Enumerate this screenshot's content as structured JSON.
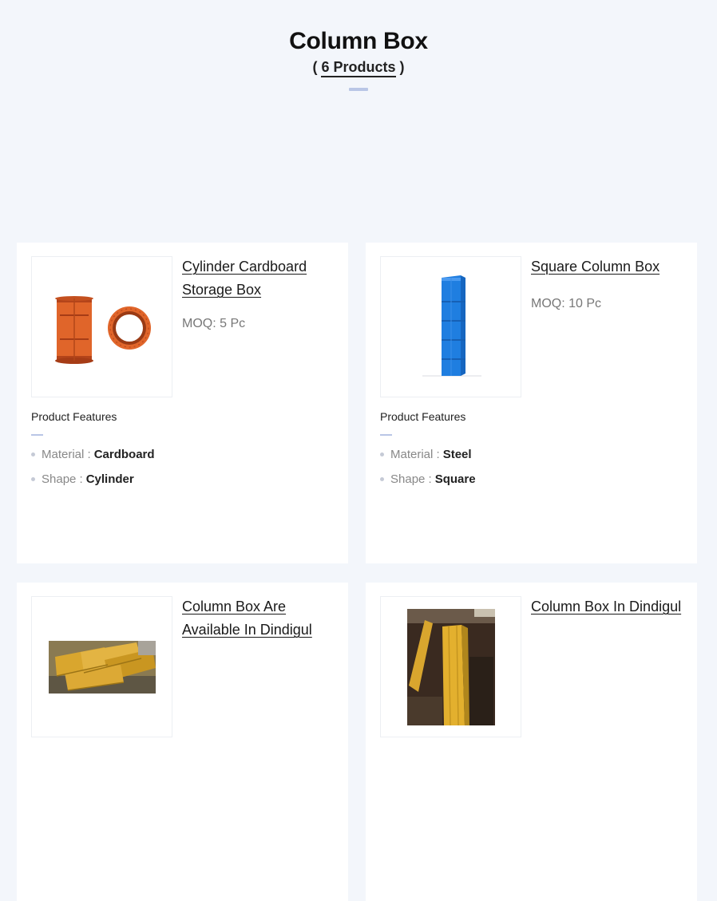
{
  "header": {
    "title": "Column Box",
    "count_prefix": "( ",
    "count_label": "6 Products",
    "count_suffix": " )"
  },
  "products": [
    {
      "name": "Cylinder Cardboard Storage Box",
      "moq": "MOQ: 5 Pc",
      "features_title": "Product Features",
      "features": [
        {
          "label": "Material :",
          "value": "Cardboard"
        },
        {
          "label": "Shape :",
          "value": "Cylinder"
        }
      ]
    },
    {
      "name": "Square Column Box",
      "moq": "MOQ: 10 Pc",
      "features_title": "Product Features",
      "features": [
        {
          "label": "Material :",
          "value": "Steel"
        },
        {
          "label": "Shape :",
          "value": "Square"
        }
      ]
    },
    {
      "name": "Column Box Are Available In Dindigul"
    },
    {
      "name": "Column Box In Dindigul"
    }
  ],
  "colors": {
    "page_bg": "#f3f6fb",
    "accent_bar": "#b9c6e6",
    "orange_product": "#e0652a",
    "blue_product": "#1f7ee0",
    "yellow_product": "#d9a62e"
  }
}
